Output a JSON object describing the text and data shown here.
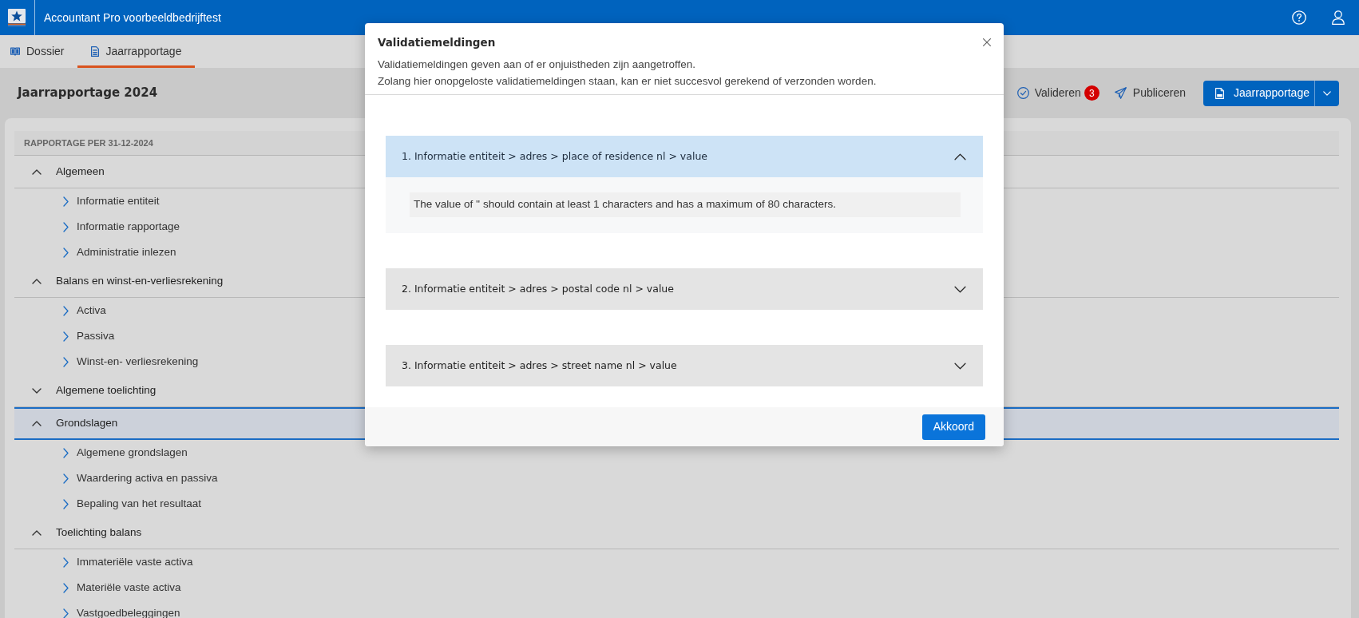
{
  "app_bar": {
    "title": "Accountant Pro voorbeeldbedrijftest"
  },
  "tabs": [
    {
      "label": "Dossier",
      "selected": false,
      "kind": "dossier"
    },
    {
      "label": "Jaarrapportage",
      "selected": true,
      "kind": "report"
    }
  ],
  "page": {
    "title": "Jaarrapportage 2024",
    "actions": [
      {
        "kind": "validate",
        "label": "Valideren",
        "badge": "3"
      },
      {
        "kind": "publish",
        "label": "Publiceren"
      },
      {
        "kind": "export",
        "label": "Jaarrapportage"
      }
    ]
  },
  "report_tree": {
    "header": "RAPPORTAGE PER 31-12-2024",
    "items": [
      {
        "label": "Algemeen",
        "expanded": true,
        "selected": false,
        "children": [
          {
            "label": "Informatie entiteit",
            "selected": false
          },
          {
            "label": "Informatie rapportage",
            "selected": false
          },
          {
            "label": "Administratie inlezen",
            "selected": false
          }
        ]
      },
      {
        "label": "Balans en winst-en-verliesrekening",
        "expanded": true,
        "selected": false,
        "children": [
          {
            "label": "Activa",
            "selected": false
          },
          {
            "label": "Passiva",
            "selected": false
          },
          {
            "label": "Winst-en- verliesrekening",
            "selected": false
          }
        ]
      },
      {
        "label": "Algemene toelichting",
        "expanded": false,
        "selected": false
      },
      {
        "label": "Grondslagen",
        "expanded": true,
        "selected": true,
        "children": [
          {
            "label": "Algemene grondslagen",
            "selected": false
          },
          {
            "label": "Waardering activa en passiva",
            "selected": false
          },
          {
            "label": "Bepaling van het resultaat",
            "selected": false
          }
        ]
      },
      {
        "label": "Toelichting balans",
        "expanded": true,
        "selected": false,
        "children": [
          {
            "label": "Immateriële vaste activa",
            "selected": false
          },
          {
            "label": "Materiële vaste activa",
            "selected": false
          },
          {
            "label": "Vastgoedbeleggingen",
            "selected": false
          }
        ]
      }
    ]
  },
  "dialog": {
    "title": "Validatiemeldingen",
    "description": [
      "Validatiemeldingen geven aan of er onjuistheden zijn aangetroffen.",
      "Zolang hier onopgeloste validatiemeldingen staan, kan er niet succesvol gerekend of verzonden worden."
    ],
    "messages": [
      {
        "title": "1. Informatie entiteit > adres > place of residence nl > value",
        "expanded": true,
        "detail": "The value of '' should contain at least 1 characters and has a maximum of 80 characters."
      },
      {
        "title": "2. Informatie entiteit > adres > postal code nl > value",
        "expanded": false
      },
      {
        "title": "3. Informatie entiteit > adres > street name nl > value",
        "expanded": false
      }
    ],
    "buttons": [
      "Akkoord"
    ]
  }
}
